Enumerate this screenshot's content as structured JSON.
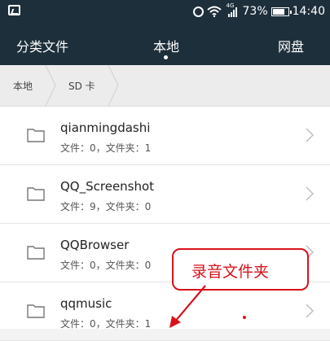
{
  "status_bar": {
    "battery_percent": "73%",
    "time": "14:40",
    "network_type": "4G",
    "icons": [
      "image-icon",
      "alarm-icon",
      "wifi-icon",
      "signal-icon",
      "battery-icon"
    ]
  },
  "tabs": {
    "category": "分类文件",
    "local": "本地",
    "cloud": "网盘",
    "active": "local"
  },
  "breadcrumb": {
    "items": [
      "本地",
      "SD 卡"
    ]
  },
  "files": [
    {
      "name": "qianmingdashi",
      "info": "文件：0，文件夹：1"
    },
    {
      "name": "QQ_Screenshot",
      "info": "文件：9，文件夹：0"
    },
    {
      "name": "QQBrowser",
      "info": "文件：0，文件夹：0"
    },
    {
      "name": "qqmusic",
      "info": "文件：0，文件夹：1"
    }
  ],
  "annotation": {
    "label": "录音文件夹",
    "color": "#d9111b"
  },
  "colors": {
    "header_bg": "#1d2f3b",
    "list_bg": "#ffffff"
  }
}
